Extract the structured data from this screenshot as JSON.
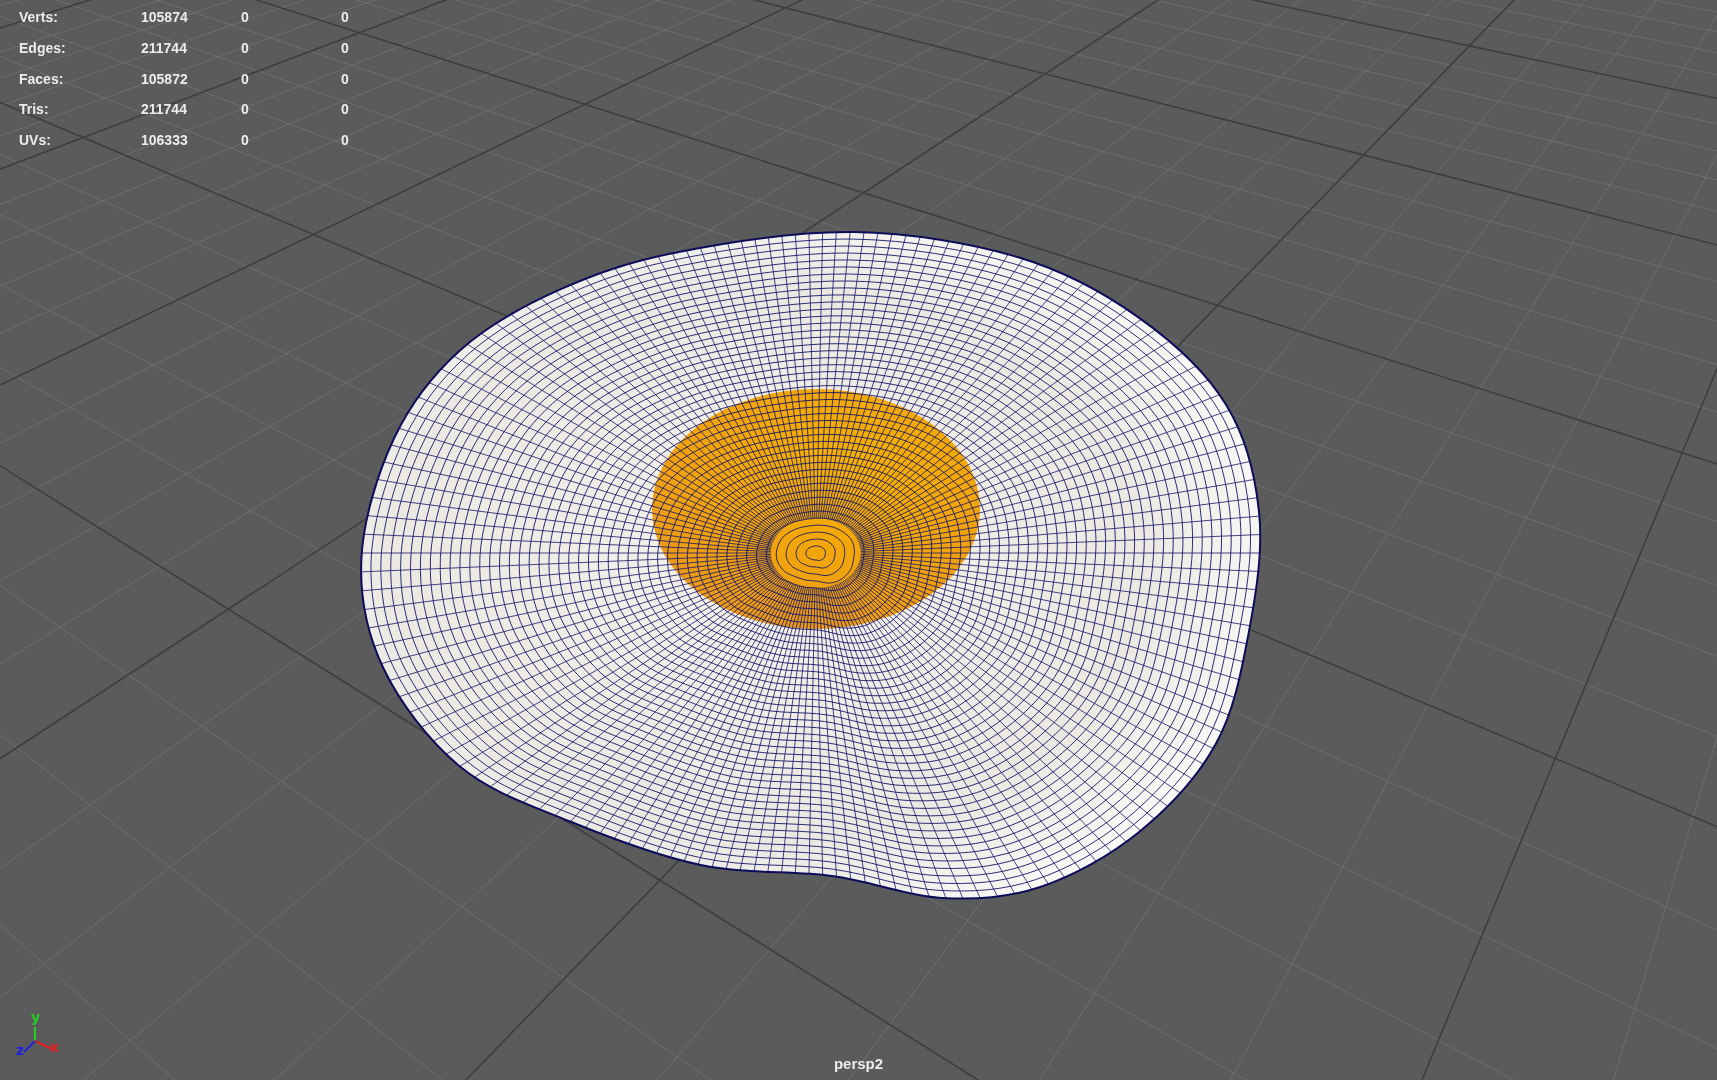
{
  "heads_up_display": {
    "rows": [
      {
        "label": "Verts:",
        "values": [
          "105874",
          "0",
          "0"
        ]
      },
      {
        "label": "Edges:",
        "values": [
          "211744",
          "0",
          "0"
        ]
      },
      {
        "label": "Faces:",
        "values": [
          "105872",
          "0",
          "0"
        ]
      },
      {
        "label": "Tris:",
        "values": [
          "211744",
          "0",
          "0"
        ]
      },
      {
        "label": "UVs:",
        "values": [
          "106333",
          "0",
          "0"
        ]
      }
    ]
  },
  "axis_gizmo": {
    "x": "x",
    "y": "y",
    "z": "z"
  },
  "camera_name": "persp2"
}
